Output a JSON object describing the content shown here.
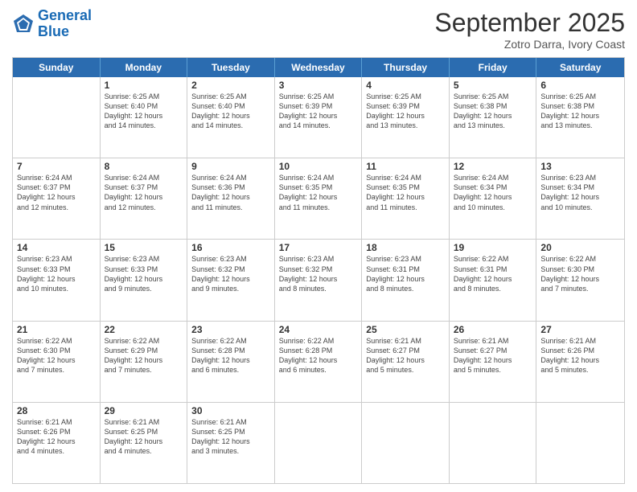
{
  "header": {
    "logo_line1": "General",
    "logo_line2": "Blue",
    "month": "September 2025",
    "location": "Zotro Darra, Ivory Coast"
  },
  "days_of_week": [
    "Sunday",
    "Monday",
    "Tuesday",
    "Wednesday",
    "Thursday",
    "Friday",
    "Saturday"
  ],
  "weeks": [
    [
      {
        "day": "",
        "info": ""
      },
      {
        "day": "1",
        "info": "Sunrise: 6:25 AM\nSunset: 6:40 PM\nDaylight: 12 hours\nand 14 minutes."
      },
      {
        "day": "2",
        "info": "Sunrise: 6:25 AM\nSunset: 6:40 PM\nDaylight: 12 hours\nand 14 minutes."
      },
      {
        "day": "3",
        "info": "Sunrise: 6:25 AM\nSunset: 6:39 PM\nDaylight: 12 hours\nand 14 minutes."
      },
      {
        "day": "4",
        "info": "Sunrise: 6:25 AM\nSunset: 6:39 PM\nDaylight: 12 hours\nand 13 minutes."
      },
      {
        "day": "5",
        "info": "Sunrise: 6:25 AM\nSunset: 6:38 PM\nDaylight: 12 hours\nand 13 minutes."
      },
      {
        "day": "6",
        "info": "Sunrise: 6:25 AM\nSunset: 6:38 PM\nDaylight: 12 hours\nand 13 minutes."
      }
    ],
    [
      {
        "day": "7",
        "info": "Sunrise: 6:24 AM\nSunset: 6:37 PM\nDaylight: 12 hours\nand 12 minutes."
      },
      {
        "day": "8",
        "info": "Sunrise: 6:24 AM\nSunset: 6:37 PM\nDaylight: 12 hours\nand 12 minutes."
      },
      {
        "day": "9",
        "info": "Sunrise: 6:24 AM\nSunset: 6:36 PM\nDaylight: 12 hours\nand 11 minutes."
      },
      {
        "day": "10",
        "info": "Sunrise: 6:24 AM\nSunset: 6:35 PM\nDaylight: 12 hours\nand 11 minutes."
      },
      {
        "day": "11",
        "info": "Sunrise: 6:24 AM\nSunset: 6:35 PM\nDaylight: 12 hours\nand 11 minutes."
      },
      {
        "day": "12",
        "info": "Sunrise: 6:24 AM\nSunset: 6:34 PM\nDaylight: 12 hours\nand 10 minutes."
      },
      {
        "day": "13",
        "info": "Sunrise: 6:23 AM\nSunset: 6:34 PM\nDaylight: 12 hours\nand 10 minutes."
      }
    ],
    [
      {
        "day": "14",
        "info": "Sunrise: 6:23 AM\nSunset: 6:33 PM\nDaylight: 12 hours\nand 10 minutes."
      },
      {
        "day": "15",
        "info": "Sunrise: 6:23 AM\nSunset: 6:33 PM\nDaylight: 12 hours\nand 9 minutes."
      },
      {
        "day": "16",
        "info": "Sunrise: 6:23 AM\nSunset: 6:32 PM\nDaylight: 12 hours\nand 9 minutes."
      },
      {
        "day": "17",
        "info": "Sunrise: 6:23 AM\nSunset: 6:32 PM\nDaylight: 12 hours\nand 8 minutes."
      },
      {
        "day": "18",
        "info": "Sunrise: 6:23 AM\nSunset: 6:31 PM\nDaylight: 12 hours\nand 8 minutes."
      },
      {
        "day": "19",
        "info": "Sunrise: 6:22 AM\nSunset: 6:31 PM\nDaylight: 12 hours\nand 8 minutes."
      },
      {
        "day": "20",
        "info": "Sunrise: 6:22 AM\nSunset: 6:30 PM\nDaylight: 12 hours\nand 7 minutes."
      }
    ],
    [
      {
        "day": "21",
        "info": "Sunrise: 6:22 AM\nSunset: 6:30 PM\nDaylight: 12 hours\nand 7 minutes."
      },
      {
        "day": "22",
        "info": "Sunrise: 6:22 AM\nSunset: 6:29 PM\nDaylight: 12 hours\nand 7 minutes."
      },
      {
        "day": "23",
        "info": "Sunrise: 6:22 AM\nSunset: 6:28 PM\nDaylight: 12 hours\nand 6 minutes."
      },
      {
        "day": "24",
        "info": "Sunrise: 6:22 AM\nSunset: 6:28 PM\nDaylight: 12 hours\nand 6 minutes."
      },
      {
        "day": "25",
        "info": "Sunrise: 6:21 AM\nSunset: 6:27 PM\nDaylight: 12 hours\nand 5 minutes."
      },
      {
        "day": "26",
        "info": "Sunrise: 6:21 AM\nSunset: 6:27 PM\nDaylight: 12 hours\nand 5 minutes."
      },
      {
        "day": "27",
        "info": "Sunrise: 6:21 AM\nSunset: 6:26 PM\nDaylight: 12 hours\nand 5 minutes."
      }
    ],
    [
      {
        "day": "28",
        "info": "Sunrise: 6:21 AM\nSunset: 6:26 PM\nDaylight: 12 hours\nand 4 minutes."
      },
      {
        "day": "29",
        "info": "Sunrise: 6:21 AM\nSunset: 6:25 PM\nDaylight: 12 hours\nand 4 minutes."
      },
      {
        "day": "30",
        "info": "Sunrise: 6:21 AM\nSunset: 6:25 PM\nDaylight: 12 hours\nand 3 minutes."
      },
      {
        "day": "",
        "info": ""
      },
      {
        "day": "",
        "info": ""
      },
      {
        "day": "",
        "info": ""
      },
      {
        "day": "",
        "info": ""
      }
    ]
  ]
}
